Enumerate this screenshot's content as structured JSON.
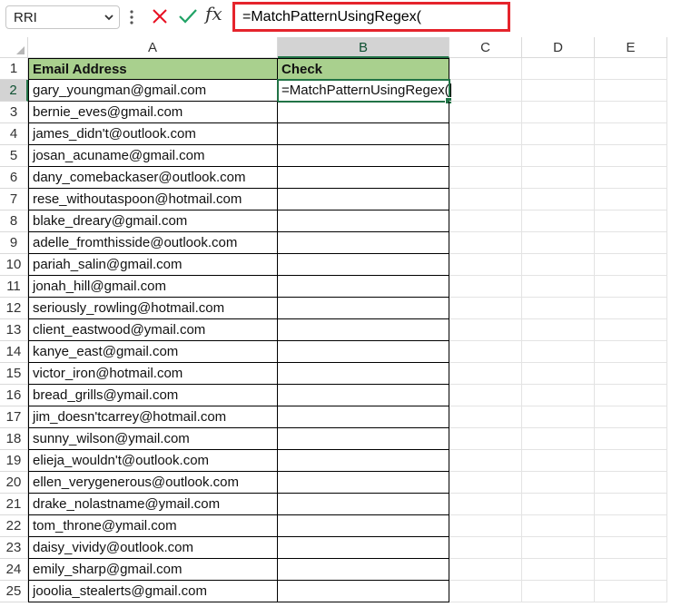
{
  "formula_bar": {
    "name_box": "RRI",
    "formula": "=MatchPatternUsingRegex("
  },
  "columns": [
    "A",
    "B",
    "C",
    "D",
    "E"
  ],
  "header_row": {
    "row": "1",
    "a": "Email Address",
    "b": "Check"
  },
  "active_cell": {
    "row": "2",
    "value": "=MatchPatternUsingRegex("
  },
  "rows": [
    {
      "num": "2",
      "email": "gary_youngman@gmail.com"
    },
    {
      "num": "3",
      "email": "bernie_eves@gmail.com"
    },
    {
      "num": "4",
      "email": "james_didn't@outlook.com"
    },
    {
      "num": "5",
      "email": "josan_acuname@gmail.com"
    },
    {
      "num": "6",
      "email": "dany_comebackaser@outlook.com"
    },
    {
      "num": "7",
      "email": "rese_withoutaspoon@hotmail.com"
    },
    {
      "num": "8",
      "email": "blake_dreary@gmail.com"
    },
    {
      "num": "9",
      "email": "adelle_fromthisside@outlook.com"
    },
    {
      "num": "10",
      "email": "pariah_salin@gmail.com"
    },
    {
      "num": "11",
      "email": "jonah_hill@gmail.com"
    },
    {
      "num": "12",
      "email": "seriously_rowling@hotmail.com"
    },
    {
      "num": "13",
      "email": "client_eastwood@ymail.com"
    },
    {
      "num": "14",
      "email": "kanye_east@gmail.com"
    },
    {
      "num": "15",
      "email": "victor_iron@hotmail.com"
    },
    {
      "num": "16",
      "email": "bread_grills@ymail.com"
    },
    {
      "num": "17",
      "email": "jim_doesn'tcarrey@hotmail.com"
    },
    {
      "num": "18",
      "email": "sunny_wilson@ymail.com"
    },
    {
      "num": "19",
      "email": "elieja_wouldn't@outlook.com"
    },
    {
      "num": "20",
      "email": "ellen_verygenerous@outlook.com"
    },
    {
      "num": "21",
      "email": "drake_nolastname@ymail.com"
    },
    {
      "num": "22",
      "email": "tom_throne@ymail.com"
    },
    {
      "num": "23",
      "email": "daisy_vividy@outlook.com"
    },
    {
      "num": "24",
      "email": "emily_sharp@gmail.com"
    },
    {
      "num": "25",
      "email": "jooolia_stealerts@gmail.com"
    }
  ],
  "colors": {
    "header_fill": "#a9d08e",
    "selection": "#217346",
    "highlight_box": "#e5242c"
  },
  "icons": [
    "chevron-down-icon",
    "more-vertical-icon",
    "cancel-icon",
    "checkmark-icon",
    "fx-icon"
  ]
}
